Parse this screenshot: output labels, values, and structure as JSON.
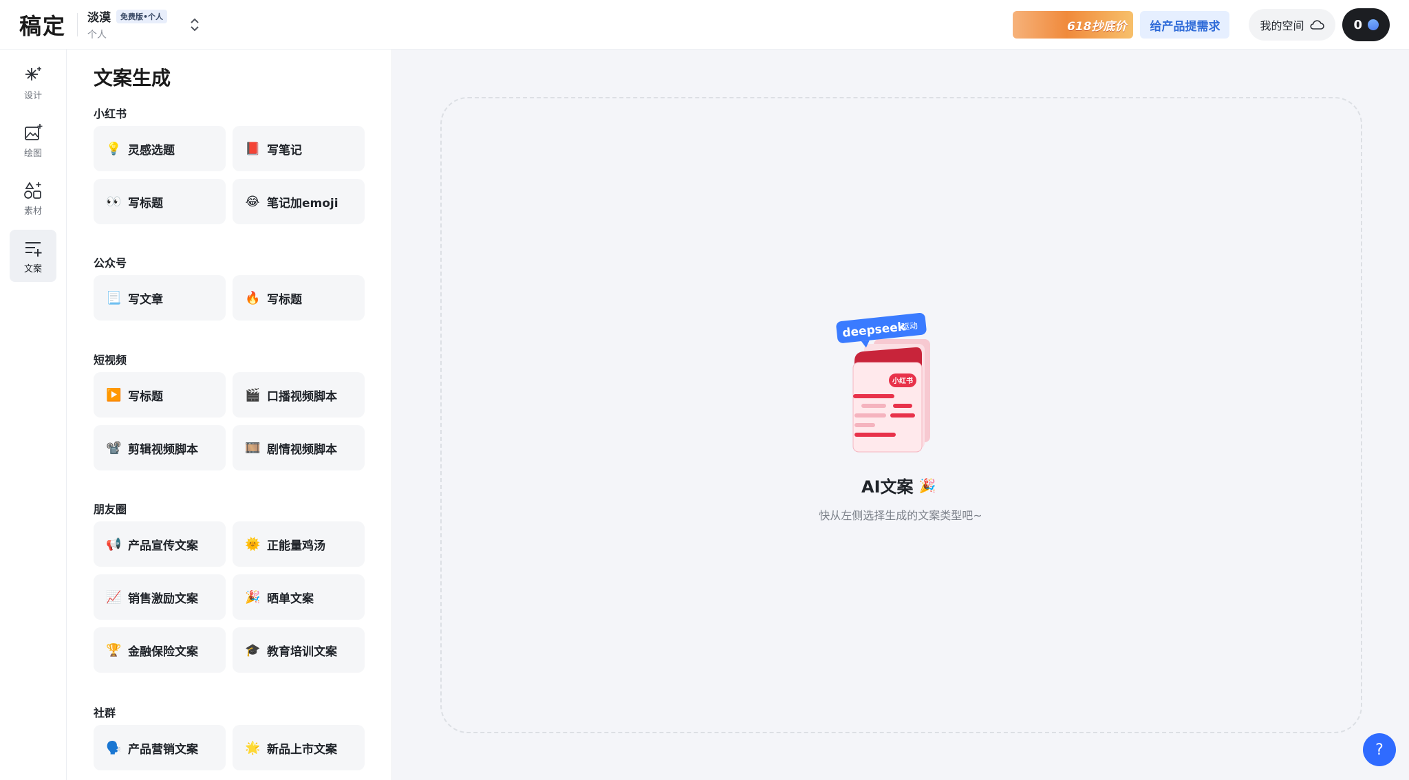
{
  "header": {
    "logo": "稿定",
    "team_name": "淡漠",
    "team_badge": "免费版•个人",
    "team_type": "个人",
    "promo_label": "618抄底价",
    "feedback_label": "给产品提需求",
    "space_label": "我的空间",
    "credits": "0"
  },
  "rail": {
    "items": [
      {
        "label": "设计",
        "icon": "sparkle-icon"
      },
      {
        "label": "绘图",
        "icon": "image-plus-icon"
      },
      {
        "label": "素材",
        "icon": "shapes-icon"
      },
      {
        "label": "文案",
        "icon": "text-plus-icon"
      }
    ],
    "active": "文案"
  },
  "panel": {
    "title": "文案生成",
    "sections": [
      {
        "title": "小红书",
        "cards": [
          {
            "emoji": "💡",
            "label": "灵感选题"
          },
          {
            "emoji": "📕",
            "label": "写笔记"
          },
          {
            "emoji": "👀",
            "label": "写标题"
          },
          {
            "emoji": "😂",
            "label": "笔记加emoji"
          }
        ]
      },
      {
        "title": "公众号",
        "cards": [
          {
            "emoji": "📃",
            "label": "写文章"
          },
          {
            "emoji": "🔥",
            "label": "写标题"
          }
        ]
      },
      {
        "title": "短视频",
        "cards": [
          {
            "emoji": "▶️",
            "label": "写标题"
          },
          {
            "emoji": "🎬",
            "label": "口播视频脚本"
          },
          {
            "emoji": "📽️",
            "label": "剪辑视频脚本"
          },
          {
            "emoji": "🎞️",
            "label": "剧情视频脚本"
          }
        ]
      },
      {
        "title": "朋友圈",
        "cards": [
          {
            "emoji": "📢",
            "label": "产品宣传文案"
          },
          {
            "emoji": "🌞",
            "label": "正能量鸡汤"
          },
          {
            "emoji": "📈",
            "label": "销售激励文案"
          },
          {
            "emoji": "🎉",
            "label": "晒单文案"
          },
          {
            "emoji": "🏆",
            "label": "金融保险文案"
          },
          {
            "emoji": "🎓",
            "label": "教育培训文案"
          }
        ]
      },
      {
        "title": "社群",
        "cards": [
          {
            "emoji": "🗣️",
            "label": "产品营销文案"
          },
          {
            "emoji": "🌟",
            "label": "新品上市文案"
          }
        ]
      }
    ]
  },
  "main": {
    "badge": "deepseek",
    "badge_suffix": "驱动",
    "book_tag": "小红书",
    "title": "AI文案",
    "title_emoji": "🎉",
    "subtitle": "快从左侧选择生成的文案类型吧~"
  },
  "help_label": "?",
  "colors": {
    "accent": "#2f6bff",
    "brand_red": "#e8324a"
  }
}
